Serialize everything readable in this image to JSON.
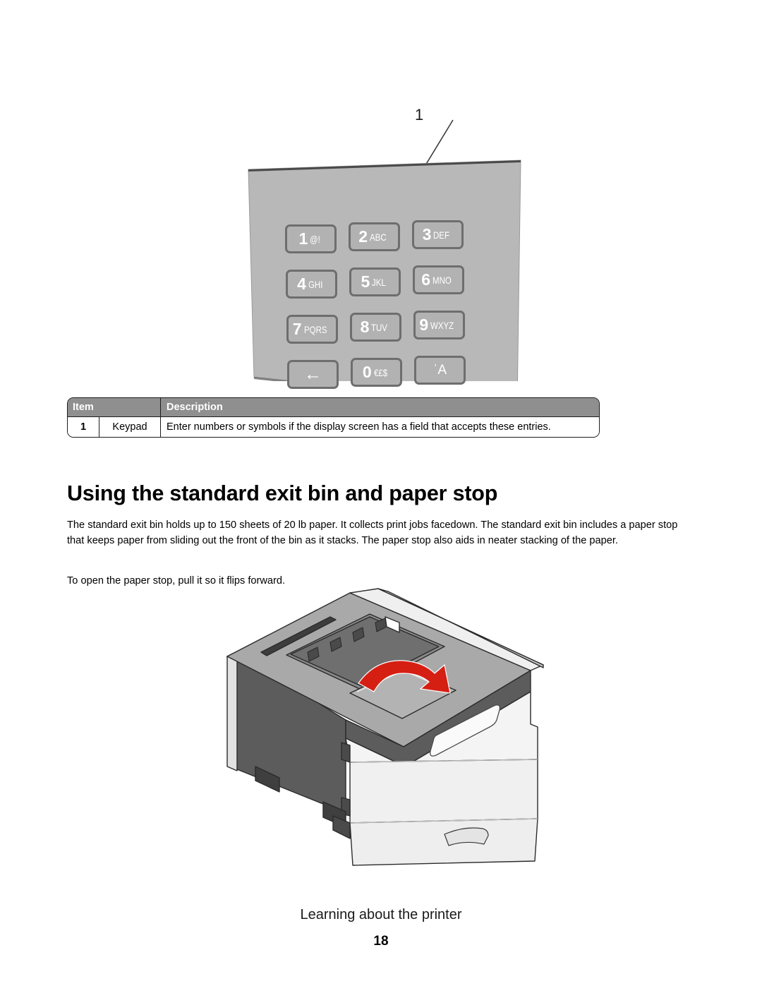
{
  "page": {
    "number": "18",
    "footer_title": "Learning about the printer"
  },
  "figure_keypad": {
    "callout_label": "1",
    "keys": [
      {
        "digit": "1",
        "letters": "@!"
      },
      {
        "digit": "2",
        "letters": "ABC"
      },
      {
        "digit": "3",
        "letters": "DEF"
      },
      {
        "digit": "4",
        "letters": "GHI"
      },
      {
        "digit": "5",
        "letters": "JKL"
      },
      {
        "digit": "6",
        "letters": "MNO"
      },
      {
        "digit": "7",
        "letters": "PQRS"
      },
      {
        "digit": "8",
        "letters": "TUV"
      },
      {
        "digit": "9",
        "letters": "WXYZ"
      },
      {
        "digit": "←",
        "letters": ""
      },
      {
        "digit": "0",
        "letters": "€£$"
      },
      {
        "digit": "ˈA",
        "letters": ""
      }
    ],
    "panel_color": "#b8b8b8",
    "key_color": "#b2b2b2",
    "key_border_color": "#6e6e6e",
    "key_text_color": "#ffffff"
  },
  "item_table": {
    "headers": [
      "Item",
      "Description"
    ],
    "rows": [
      {
        "number": "1",
        "name": "Keypad",
        "description": "Enter numbers or symbols if the display screen has a field that accepts these entries."
      }
    ],
    "header_bg": "#8f8f8f",
    "border_color": "#1c1c1c"
  },
  "section": {
    "heading": "Using the standard exit bin and paper stop",
    "paragraph_1": "The standard exit bin holds up to 150 sheets of 20 lb paper. It collects print jobs facedown. The standard exit bin includes a paper stop that keeps paper from sliding out the front of the bin as it stacks. The paper stop also aids in neater stacking of the paper.",
    "paragraph_2": "To open the paper stop, pull it so it flips forward."
  },
  "figure_printer": {
    "caption": "",
    "arrow_color": "#d61f13",
    "body_dark": "#5c5c5c",
    "body_light": "#f2f2f2",
    "top_gray": "#a8a8a8"
  }
}
